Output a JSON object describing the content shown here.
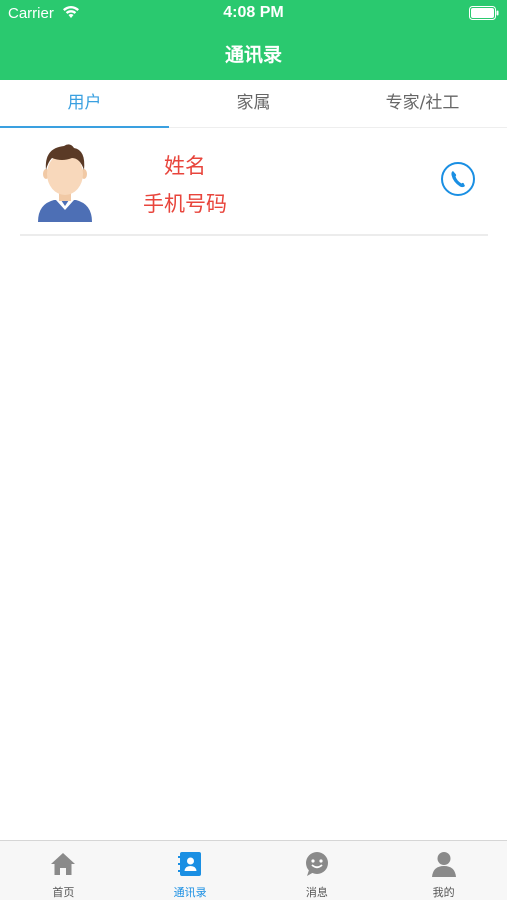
{
  "status_bar": {
    "carrier": "Carrier",
    "time": "4:08 PM"
  },
  "header": {
    "title": "通讯录",
    "background_color": "#2ac96f"
  },
  "tabs": [
    {
      "label": "用户",
      "active": true
    },
    {
      "label": "家属",
      "active": false
    },
    {
      "label": "专家/社工",
      "active": false
    }
  ],
  "contacts": [
    {
      "name": "姓名",
      "phone": "手机号码",
      "avatar_icon": "male-avatar-icon",
      "action_icon": "phone-icon"
    }
  ],
  "tabbar": [
    {
      "label": "首页",
      "icon": "home-icon",
      "active": false
    },
    {
      "label": "通讯录",
      "icon": "contacts-icon",
      "active": true
    },
    {
      "label": "消息",
      "icon": "message-icon",
      "active": false
    },
    {
      "label": "我的",
      "icon": "profile-icon",
      "active": false
    }
  ],
  "colors": {
    "accent": "#3aa0e0",
    "contact_text": "#e8453c",
    "tabbar_active": "#1a8fe3"
  }
}
